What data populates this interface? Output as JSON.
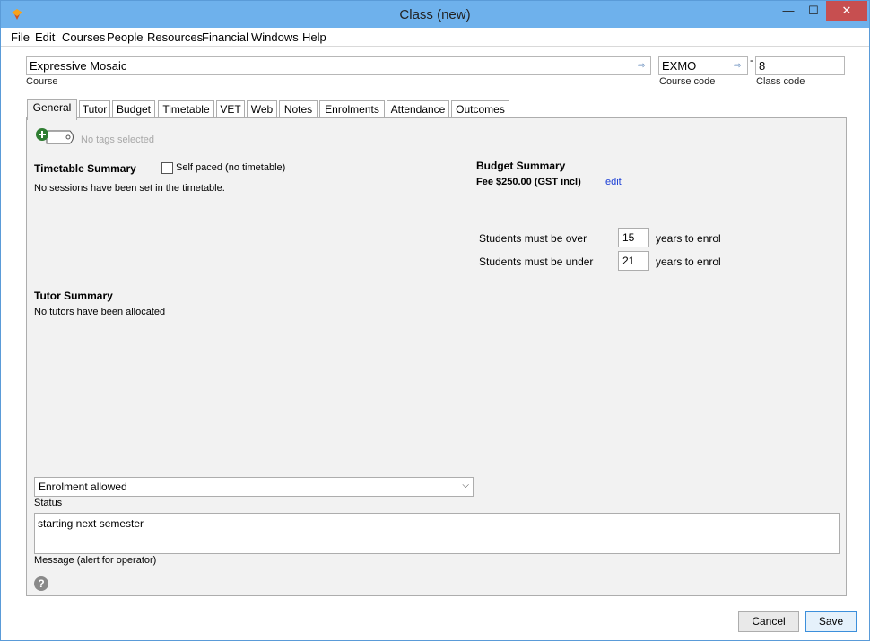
{
  "window": {
    "title": "Class (new)",
    "min_glyph": "—",
    "max_glyph": "☐",
    "close_glyph": "✕"
  },
  "menu": [
    "File",
    "Edit",
    "Courses",
    "People",
    "Resources",
    "Financial",
    "Windows",
    "Help"
  ],
  "header": {
    "course_value": "Expressive Mosaic",
    "course_label": "Course",
    "course_code_value": "EXMO",
    "course_code_label": "Course code",
    "separator": "-",
    "class_code_value": "8",
    "class_code_label": "Class code",
    "arrow_glyph": "⇨"
  },
  "tabs": [
    "General",
    "Tutor",
    "Budget",
    "Timetable",
    "VET",
    "Web",
    "Notes",
    "Enrolments",
    "Attendance",
    "Outcomes"
  ],
  "general": {
    "tags_text": "No tags selected",
    "timetable_title": "Timetable Summary",
    "self_paced_label": "Self paced (no timetable)",
    "timetable_text": "No sessions have been set in the timetable.",
    "budget_title": "Budget Summary",
    "fee_text": "Fee $250.00 (GST incl)",
    "edit_link": "edit",
    "over_label": "Students must be over",
    "over_value": "15",
    "under_label": "Students must be under",
    "under_value": "21",
    "years_label_1": "years to enrol",
    "years_label_2": "years to enrol",
    "tutor_title": "Tutor Summary",
    "tutor_text": "No tutors have been allocated",
    "status_value": "Enrolment allowed",
    "status_label": "Status",
    "message_value": "starting next semester",
    "message_label": "Message (alert for operator)",
    "help_glyph": "?"
  },
  "buttons": {
    "cancel": "Cancel",
    "save": "Save"
  },
  "colors": {
    "titlebar": "#6eb1ec",
    "close": "#c74f50",
    "link": "#1b3fd6"
  }
}
